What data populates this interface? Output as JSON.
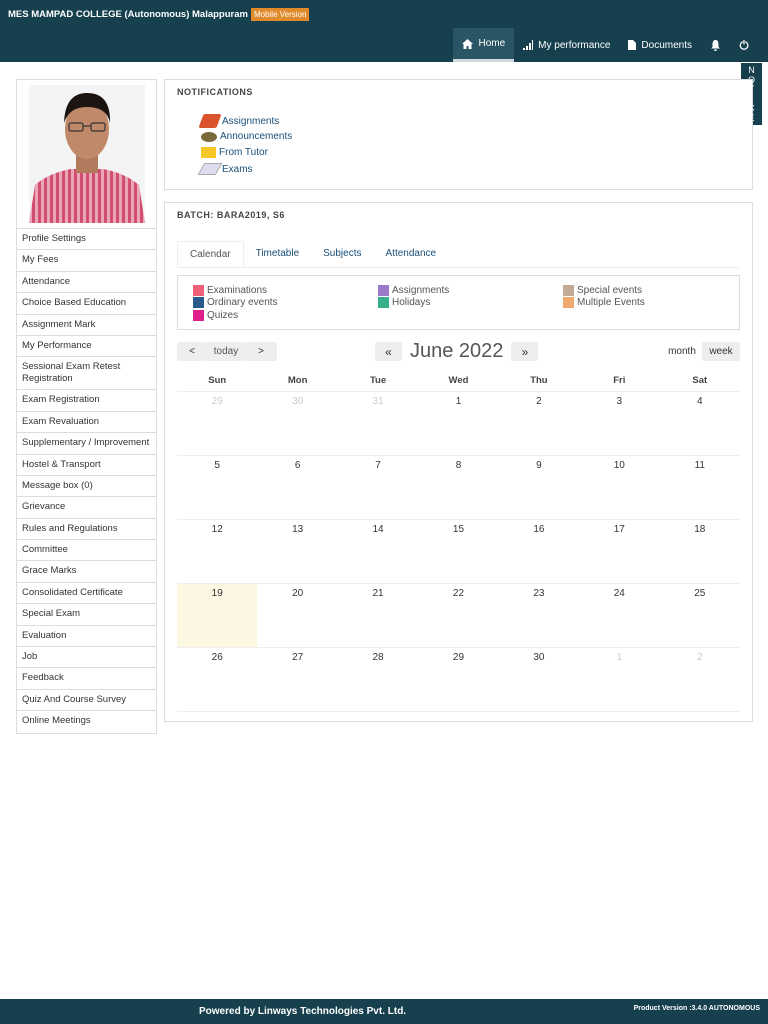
{
  "header": {
    "title": "MES MAMPAD COLLEGE (Autonomous) Malappuram",
    "badge": "Mobile Version",
    "nav": [
      {
        "label": "Home",
        "icon": "home-icon"
      },
      {
        "label": "My performance",
        "icon": "bar-chart-icon"
      },
      {
        "label": "Documents",
        "icon": "document-icon"
      }
    ]
  },
  "notice_tab": [
    "N",
    "O",
    "T",
    "I",
    "C",
    "E"
  ],
  "sidebar": {
    "items": [
      "Profile Settings",
      "My Fees",
      "Attendance",
      "Choice Based Education",
      "Assignment Mark",
      "My Performance",
      "Sessional Exam Retest Registration",
      "Exam Registration",
      "Exam Revaluation",
      "Supplementary / Improvement",
      "Hostel & Transport",
      "Message box (0)",
      "Grievance",
      "Rules and Regulations",
      "Committee",
      "Grace Marks",
      "Consolidated Certificate",
      "Special Exam",
      "Evaluation",
      "Job",
      "Feedback",
      "Quiz And Course Survey",
      "Online Meetings"
    ]
  },
  "notifications": {
    "title": "NOTIFICATIONS",
    "items": [
      "Assignments",
      "Announcements",
      "From Tutor",
      "Exams"
    ]
  },
  "batch": {
    "title": "BATCH: BARA2019, S6",
    "tabs": [
      "Calendar",
      "Timetable",
      "Subjects",
      "Attendance"
    ],
    "legend": [
      {
        "label": "Examinations",
        "color": "#f0607a"
      },
      {
        "label": "Assignments",
        "color": "#9b7bc9"
      },
      {
        "label": "Special events",
        "color": "#c2ab96"
      },
      {
        "label": "Ordinary events",
        "color": "#2a5a8c"
      },
      {
        "label": "Holidays",
        "color": "#36b08a"
      },
      {
        "label": "Multiple Events",
        "color": "#f0aa6e"
      },
      {
        "label": "Quizes",
        "color": "#e0208a"
      }
    ]
  },
  "calendar": {
    "title": "June 2022",
    "today": "today",
    "prev": "<",
    "next": ">",
    "prev_year": "«",
    "next_year": "»",
    "month": "month",
    "week": "week",
    "days": [
      "Sun",
      "Mon",
      "Tue",
      "Wed",
      "Thu",
      "Fri",
      "Sat"
    ],
    "weeks": [
      [
        "29",
        "30",
        "31",
        "1",
        "2",
        "3",
        "4"
      ],
      [
        "5",
        "6",
        "7",
        "8",
        "9",
        "10",
        "11"
      ],
      [
        "12",
        "13",
        "14",
        "15",
        "16",
        "17",
        "18"
      ],
      [
        "19",
        "20",
        "21",
        "22",
        "23",
        "24",
        "25"
      ],
      [
        "26",
        "27",
        "28",
        "29",
        "30",
        "1",
        "2"
      ]
    ],
    "today_date": "19"
  },
  "footer": {
    "powered": "Powered by Linways Technologies Pvt. Ltd.",
    "version": "Product Version :3.4.0 AUTONOMOUS"
  }
}
